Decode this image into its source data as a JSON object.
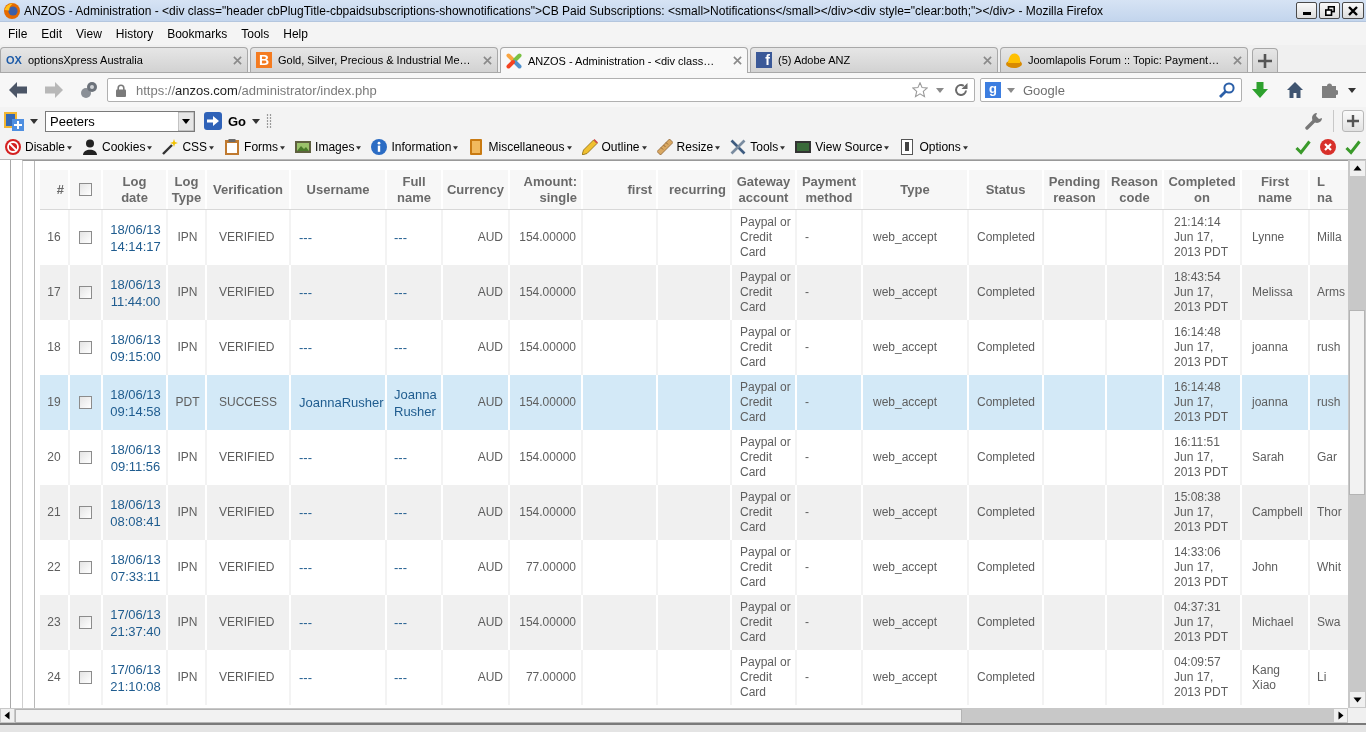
{
  "window": {
    "title": "ANZOS - Administration - <div class=\"header cbPlugTitle-cbpaidsubscriptions-shownotifications\">CB Paid Subscriptions: <small>Notifications</small></div><div style=\"clear:both;\"></div> - Mozilla Firefox"
  },
  "menu_bar": [
    "File",
    "Edit",
    "View",
    "History",
    "Bookmarks",
    "Tools",
    "Help"
  ],
  "tabs": [
    {
      "label": "optionsXpress Australia",
      "logo": "OX",
      "selected": false
    },
    {
      "label": "Gold, Silver, Precious & Industrial Me…",
      "logo": "B",
      "selected": false
    },
    {
      "label": "ANZOS - Administration - <div class…",
      "selected": true
    },
    {
      "label": "(5) Adobe ANZ",
      "logo": "f",
      "selected": false
    },
    {
      "label": "Joomlapolis Forum :: Topic: Payment…",
      "selected": false
    }
  ],
  "navigation": {
    "back": {
      "disabled": false
    },
    "forward": {
      "disabled": true
    },
    "url": {
      "scheme": "https://",
      "host": "anzos.com",
      "path": "/administrator/index.php"
    },
    "search": {
      "logo": "g",
      "placeholder": "Google"
    }
  },
  "dictionary_toolbar": {
    "dictionary": "Peeters",
    "go": "Go"
  },
  "web_developer_toolbar": [
    "Disable",
    "Cookies",
    "CSS",
    "Forms",
    "Images",
    "Information",
    "Miscellaneous",
    "Outline",
    "Resize",
    "Tools",
    "View Source",
    "Options"
  ],
  "table": {
    "columns": [
      {
        "label": "#",
        "kind": "index"
      },
      {
        "kind": "checkbox",
        "checked": false
      },
      {
        "label": "Log date",
        "kind": "date"
      },
      {
        "label": "Log Type",
        "kind": "code"
      },
      {
        "label": "Verification",
        "kind": "text"
      },
      {
        "label": "Username",
        "kind": "link"
      },
      {
        "label": "Full name",
        "kind": "link"
      },
      {
        "label": "Currency",
        "kind": "number"
      },
      {
        "label": "Amount: single",
        "kind": "number"
      },
      {
        "label": "first",
        "kind": "number"
      },
      {
        "label": "recurring",
        "kind": "number"
      },
      {
        "label": "Gateway account",
        "kind": "text"
      },
      {
        "label": "Payment method",
        "kind": "text"
      },
      {
        "label": "Type",
        "kind": "text"
      },
      {
        "label": "Status",
        "kind": "text"
      },
      {
        "label": "Pending reason",
        "kind": "text"
      },
      {
        "label": "Reason code",
        "kind": "text"
      },
      {
        "label": "Completed on",
        "kind": "text"
      },
      {
        "label": "First name",
        "kind": "text"
      },
      {
        "label": "L na",
        "kind": "text"
      }
    ],
    "rows": [
      {
        "number": "16",
        "checked": false,
        "highlighted": false,
        "log_date": "18/06/13 14:14:17",
        "log_type": "IPN",
        "verification": "VERIFIED",
        "username": "---",
        "full_name": "---",
        "currency": "AUD",
        "amount_single": "154.00000",
        "gateway_account": "Paypal or Credit Card",
        "payment_method": "-",
        "type": "web_accept",
        "status": "Completed",
        "completed_on": "21:14:14 Jun 17, 2013 PDT",
        "first_name": "Lynne",
        "column_20": "Milla"
      },
      {
        "number": "17",
        "checked": false,
        "highlighted": false,
        "log_date": "18/06/13 11:44:00",
        "log_type": "IPN",
        "verification": "VERIFIED",
        "username": "---",
        "full_name": "---",
        "currency": "AUD",
        "amount_single": "154.00000",
        "gateway_account": "Paypal or Credit Card",
        "payment_method": "-",
        "type": "web_accept",
        "status": "Completed",
        "completed_on": "18:43:54 Jun 17, 2013 PDT",
        "first_name": "Melissa",
        "column_20": "Arms"
      },
      {
        "number": "18",
        "checked": false,
        "highlighted": false,
        "log_date": "18/06/13 09:15:00",
        "log_type": "IPN",
        "verification": "VERIFIED",
        "username": "---",
        "full_name": "---",
        "currency": "AUD",
        "amount_single": "154.00000",
        "gateway_account": "Paypal or Credit Card",
        "payment_method": "-",
        "type": "web_accept",
        "status": "Completed",
        "completed_on": "16:14:48 Jun 17, 2013 PDT",
        "first_name": "joanna",
        "column_20": "rush"
      },
      {
        "number": "19",
        "checked": false,
        "highlighted": true,
        "log_date": "18/06/13 09:14:58",
        "log_type": "PDT",
        "verification": "SUCCESS",
        "username": "JoannaRusher",
        "full_name": "Joanna Rusher",
        "currency": "AUD",
        "amount_single": "154.00000",
        "gateway_account": "Paypal or Credit Card",
        "payment_method": "-",
        "type": "web_accept",
        "status": "Completed",
        "completed_on": "16:14:48 Jun 17, 2013 PDT",
        "first_name": "joanna",
        "column_20": "rush"
      },
      {
        "number": "20",
        "checked": false,
        "highlighted": false,
        "log_date": "18/06/13 09:11:56",
        "log_type": "IPN",
        "verification": "VERIFIED",
        "username": "---",
        "full_name": "---",
        "currency": "AUD",
        "amount_single": "154.00000",
        "gateway_account": "Paypal or Credit Card",
        "payment_method": "-",
        "type": "web_accept",
        "status": "Completed",
        "completed_on": "16:11:51 Jun 17, 2013 PDT",
        "first_name": "Sarah",
        "column_20": "Gar"
      },
      {
        "number": "21",
        "checked": false,
        "highlighted": false,
        "log_date": "18/06/13 08:08:41",
        "log_type": "IPN",
        "verification": "VERIFIED",
        "username": "---",
        "full_name": "---",
        "currency": "AUD",
        "amount_single": "154.00000",
        "gateway_account": "Paypal or Credit Card",
        "payment_method": "-",
        "type": "web_accept",
        "status": "Completed",
        "completed_on": "15:08:38 Jun 17, 2013 PDT",
        "first_name": "Campbell",
        "column_20": "Thor"
      },
      {
        "number": "22",
        "checked": false,
        "highlighted": false,
        "log_date": "18/06/13 07:33:11",
        "log_type": "IPN",
        "verification": "VERIFIED",
        "username": "---",
        "full_name": "---",
        "currency": "AUD",
        "amount_single": "77.00000",
        "gateway_account": "Paypal or Credit Card",
        "payment_method": "-",
        "type": "web_accept",
        "status": "Completed",
        "completed_on": "14:33:06 Jun 17, 2013 PDT",
        "first_name": "John",
        "column_20": "Whit"
      },
      {
        "number": "23",
        "checked": false,
        "highlighted": false,
        "log_date": "17/06/13 21:37:40",
        "log_type": "IPN",
        "verification": "VERIFIED",
        "username": "---",
        "full_name": "---",
        "currency": "AUD",
        "amount_single": "154.00000",
        "gateway_account": "Paypal or Credit Card",
        "payment_method": "-",
        "type": "web_accept",
        "status": "Completed",
        "completed_on": "04:37:31 Jun 17, 2013 PDT",
        "first_name": "Michael",
        "column_20": "Swa"
      },
      {
        "number": "24",
        "checked": false,
        "highlighted": false,
        "log_date": "17/06/13 21:10:08",
        "log_type": "IPN",
        "verification": "VERIFIED",
        "username": "---",
        "full_name": "---",
        "currency": "AUD",
        "amount_single": "77.00000",
        "gateway_account": "Paypal or Credit Card",
        "payment_method": "-",
        "type": "web_accept",
        "status": "Completed",
        "completed_on": "04:09:57 Jun 17, 2013 PDT",
        "first_name": "Kang Xiao",
        "column_20": "Li"
      }
    ]
  }
}
